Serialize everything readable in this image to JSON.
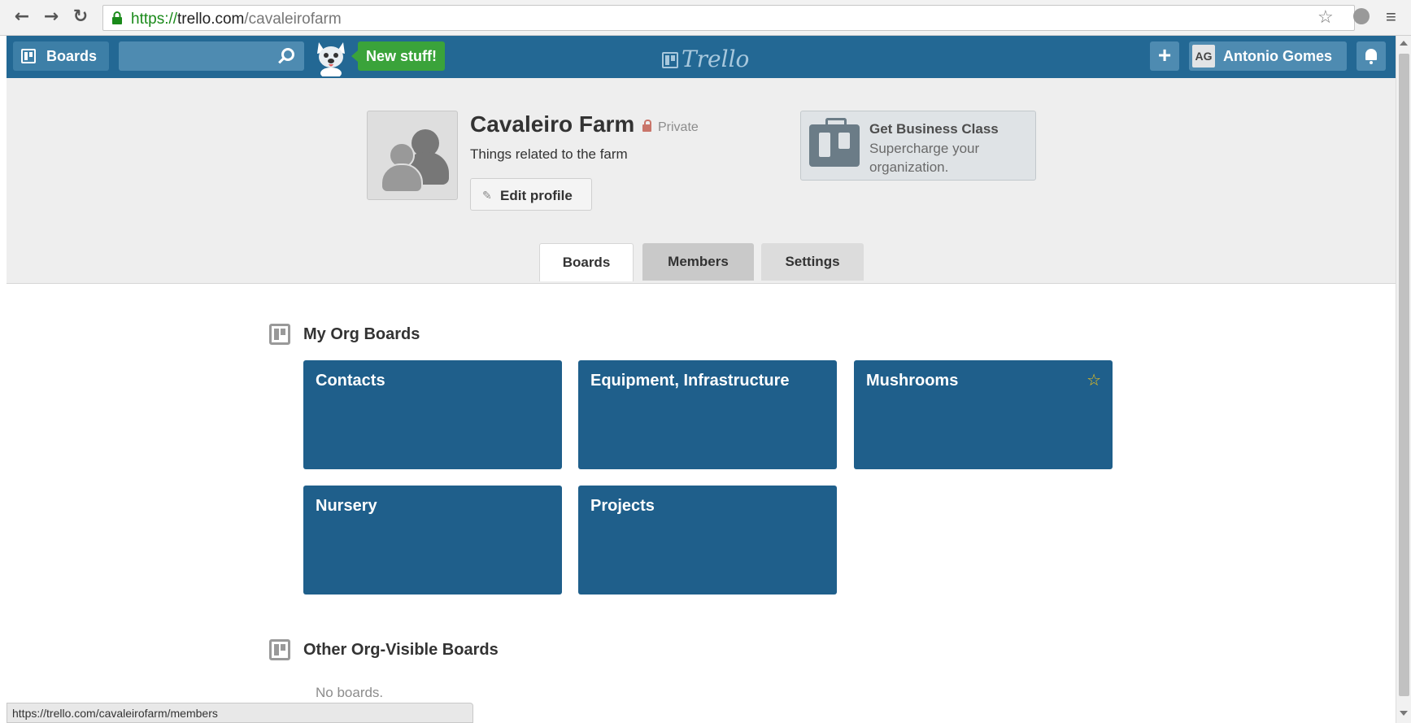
{
  "browser": {
    "url_scheme": "https://",
    "url_host": "trello.com",
    "url_path": "/cavaleirofarm",
    "back_icon": "arrow-left",
    "forward_icon": "arrow-right",
    "reload_icon": "reload",
    "status_url": "https://trello.com/cavaleirofarm/members"
  },
  "header": {
    "boards_label": "Boards",
    "new_stuff_label": "New stuff!",
    "logo_text": "Trello",
    "add_label": "+",
    "member_initials": "AG",
    "member_name": "Antonio Gomes"
  },
  "org": {
    "name": "Cavaleiro Farm",
    "visibility": "Private",
    "description": "Things related to the farm",
    "edit_profile_label": "Edit profile"
  },
  "business_class": {
    "title": "Get Business Class",
    "subtitle": "Supercharge your organization."
  },
  "tabs": [
    {
      "label": "Boards"
    },
    {
      "label": "Members"
    },
    {
      "label": "Settings"
    }
  ],
  "sections": {
    "my_org_boards": {
      "title": "My Org Boards",
      "boards": [
        {
          "name": "Contacts",
          "starred": false
        },
        {
          "name": "Equipment, Infrastructure",
          "starred": false
        },
        {
          "name": "Mushrooms",
          "starred": true
        },
        {
          "name": "Nursery",
          "starred": false
        },
        {
          "name": "Projects",
          "starred": false
        }
      ]
    },
    "other_boards": {
      "title": "Other Org-Visible Boards",
      "empty_text": "No boards."
    }
  },
  "colors": {
    "header_bg": "#236894",
    "board_tile": "#1f5f8b",
    "new_stuff": "#3aa33a",
    "star": "#f2c418"
  }
}
